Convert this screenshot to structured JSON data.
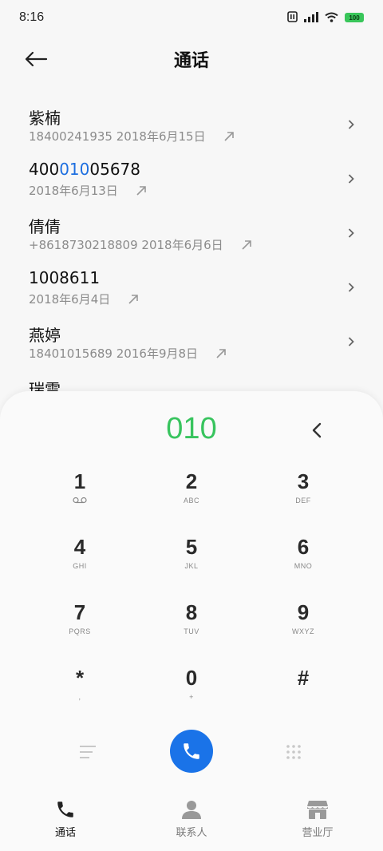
{
  "status_bar": {
    "time": "8:16",
    "battery": "100",
    "icons": [
      "sim-icon",
      "signal-icon",
      "wifi-icon",
      "battery-icon"
    ]
  },
  "header": {
    "title": "通话",
    "back_icon": "arrow-left-icon"
  },
  "calls": [
    {
      "name_parts": [
        "紫楠",
        "",
        ""
      ],
      "number": "18400241935",
      "date": "2018年6月15日"
    },
    {
      "name_parts": [
        "400",
        "010",
        "05678"
      ],
      "number": "",
      "date": "2018年6月13日"
    },
    {
      "name_parts": [
        "倩倩",
        "",
        ""
      ],
      "number": "+8618730218809",
      "date": "2018年6月6日"
    },
    {
      "name_parts": [
        "1008611",
        "",
        ""
      ],
      "number": "",
      "date": "2018年6月4日"
    },
    {
      "name_parts": [
        "燕婷",
        "",
        ""
      ],
      "number": "18401015689",
      "date": "2016年9月8日"
    },
    {
      "name_parts": [
        "瑞雪",
        "",
        ""
      ],
      "number": "",
      "date": ""
    }
  ],
  "dialer": {
    "input": "010",
    "keys": [
      {
        "digit": "1",
        "letters": "voicemail-icon"
      },
      {
        "digit": "2",
        "letters": "ABC"
      },
      {
        "digit": "3",
        "letters": "DEF"
      },
      {
        "digit": "4",
        "letters": "GHI"
      },
      {
        "digit": "5",
        "letters": "JKL"
      },
      {
        "digit": "6",
        "letters": "MNO"
      },
      {
        "digit": "7",
        "letters": "PQRS"
      },
      {
        "digit": "8",
        "letters": "TUV"
      },
      {
        "digit": "9",
        "letters": "WXYZ"
      },
      {
        "digit": "*",
        "letters": ","
      },
      {
        "digit": "0",
        "letters": "+"
      },
      {
        "digit": "#",
        "letters": ""
      }
    ]
  },
  "colors": {
    "accent": "#1a73e8",
    "dial_text": "#38c45e",
    "highlight": "#1e6fe0"
  },
  "bottom_nav": [
    {
      "label": "通话",
      "icon": "phone-icon",
      "active": true
    },
    {
      "label": "联系人",
      "icon": "person-icon",
      "active": false
    },
    {
      "label": "营业厅",
      "icon": "store-icon",
      "active": false
    }
  ]
}
